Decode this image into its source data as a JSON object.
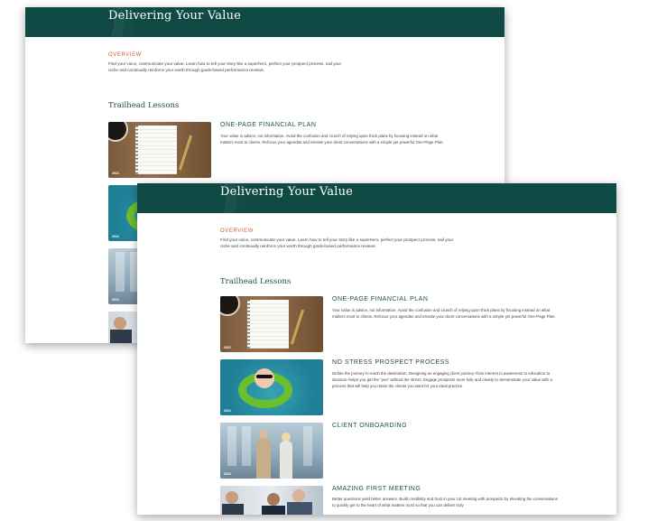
{
  "page": {
    "title": "Delivering Your Value",
    "overview_label": "OVERVIEW",
    "overview_text": "Find your voice, communicate your value. Learn how to tell your story like a superhero, perfect your prospect process, nail your niche and continually reinforce your worth through goals-based performance reviews.",
    "section_title": "Trailhead Lessons"
  },
  "lessons": [
    {
      "title": "ONE-PAGE FINANCIAL PLAN",
      "description": "Your value is advice, not information. Avoid the confusion and crunch of relying upon thick plans by focusing instead on what matters most to clients. Refocus your agendas and elevate your client conversations with a simple yet powerful One-Page Plan.",
      "year": "2021",
      "image": "desk-notebook-image"
    },
    {
      "title": "NO STRESS PROSPECT PROCESS",
      "description": "Define the journey to reach the destination. Designing an engaging client journey–from interest to awareness to education to decision–helps you get the \"yes\" without the stress. Engage prospects more fully and clearly to demonstrate your value with a process that will help you retain the clients you want for your ideal practice.",
      "year": "2021",
      "image": "pool-float-image"
    },
    {
      "title": "CLIENT ONBOARDING",
      "description": "",
      "year": "2021",
      "image": "couple-image"
    },
    {
      "title": "AMAZING FIRST MEETING",
      "description": "Better questions yield better answers. Build credibility and trust in your 1st meeting with prospects by elevating the conversations to quickly get to the heart of what matters most so that you can deliver truly",
      "year": "",
      "image": "meeting-image"
    }
  ]
}
